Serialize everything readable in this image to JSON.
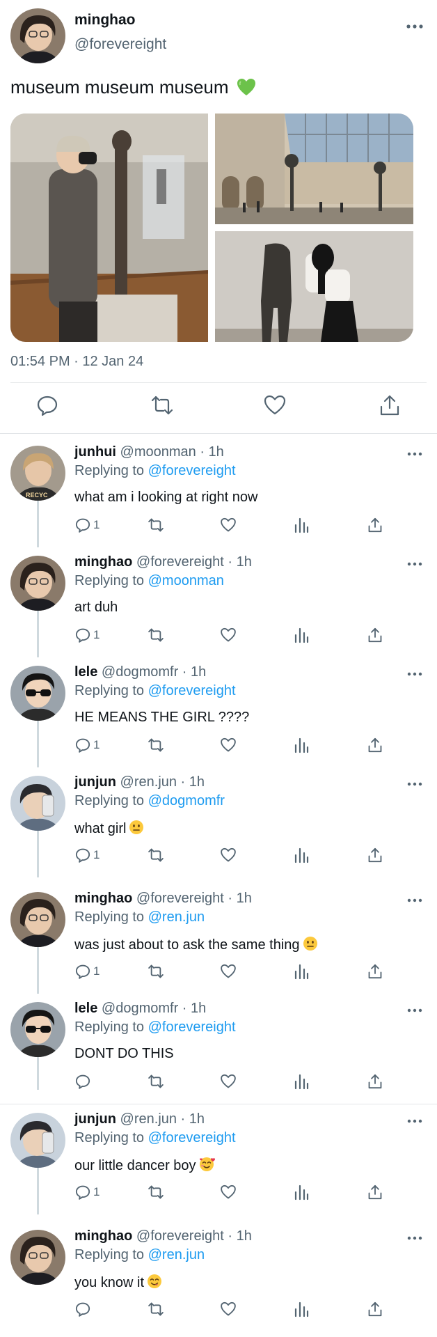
{
  "main_tweet": {
    "author_name": "minghao",
    "author_handle": "@forevereight",
    "text": "museum museum museum",
    "emoji": "green-heart",
    "timestamp": "01:54 PM · 12 Jan 24",
    "photo_count": 3
  },
  "replies": [
    {
      "name": "junhui",
      "meta": "@moonman · 1h",
      "replying_prefix": "Replying to",
      "mention": "@forevereight",
      "text": "what am i looking at right now",
      "emoji": "",
      "reply_count": "1",
      "avatar_style": "light-hair"
    },
    {
      "name": "minghao",
      "meta": "@forevereight · 1h",
      "replying_prefix": "Replying to",
      "mention": "@moonman",
      "text": "art duh",
      "emoji": "",
      "reply_count": "1",
      "avatar_style": "dark-hair"
    },
    {
      "name": "lele",
      "meta": "@dogmomfr · 1h",
      "replying_prefix": "Replying to",
      "mention": "@forevereight",
      "text": "HE MEANS THE GIRL ????",
      "emoji": "",
      "reply_count": "1",
      "avatar_style": "sunglasses"
    },
    {
      "name": "junjun",
      "meta": "@ren.jun · 1h",
      "replying_prefix": "Replying to",
      "mention": "@dogmomfr",
      "text": "what girl",
      "emoji": "neutral-face",
      "reply_count": "1",
      "avatar_style": "blue"
    },
    {
      "name": "minghao",
      "meta": "@forevereight · 1h",
      "replying_prefix": "Replying to",
      "mention": "@ren.jun",
      "text": "was just about to ask the same thing",
      "emoji": "neutral-face",
      "reply_count": "1",
      "avatar_style": "dark-hair"
    },
    {
      "name": "lele",
      "meta": "@dogmomfr · 1h",
      "replying_prefix": "Replying to",
      "mention": "@forevereight",
      "text": "DONT DO THIS",
      "emoji": "",
      "reply_count": "",
      "avatar_style": "sunglasses"
    },
    {
      "name": "junjun",
      "meta": "@ren.jun · 1h",
      "replying_prefix": "Replying to",
      "mention": "@forevereight",
      "text": "our little dancer boy",
      "emoji": "smiling-hearts",
      "reply_count": "1",
      "avatar_style": "blue"
    },
    {
      "name": "minghao",
      "meta": "@forevereight · 1h",
      "replying_prefix": "Replying to",
      "mention": "@ren.jun",
      "text": "you know it",
      "emoji": "yum-face",
      "reply_count": "",
      "avatar_style": "dark-hair"
    }
  ],
  "colors": {
    "link": "#1d9bf0",
    "secondary_text": "#536471",
    "primary_text": "#0f1419",
    "thread_line": "#cfd9de"
  }
}
